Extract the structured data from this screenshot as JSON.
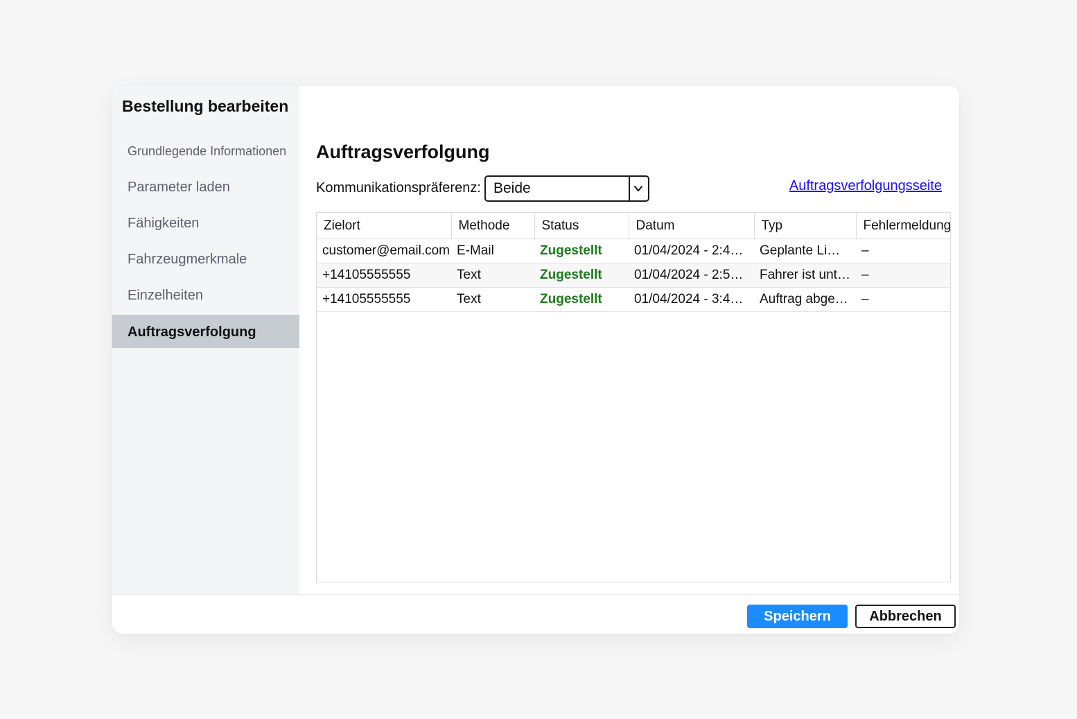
{
  "dialog": {
    "title": "Bestellung bearbeiten"
  },
  "sidebar": {
    "items": [
      {
        "label": "Grundlegende Informationen"
      },
      {
        "label": "Parameter laden"
      },
      {
        "label": "Fähigkeiten"
      },
      {
        "label": "Fahrzeugmerkmale"
      },
      {
        "label": "Einzelheiten"
      },
      {
        "label": "Auftragsverfolgung",
        "active": true
      }
    ]
  },
  "main": {
    "section_title": "Auftragsverfolgung",
    "preference_label": "Kommunikationspräferenz:",
    "preference_value": "Beide",
    "tracking_link": "Auftragsverfolgungsseite",
    "status_color": "#1c7a1c",
    "link_color": "#1a0dff",
    "table": {
      "columns": [
        "Zielort",
        "Methode",
        "Status",
        "Datum",
        "Typ",
        "Fehlermeldung"
      ],
      "rows": [
        {
          "zielort": "customer@email.com",
          "methode": "E-Mail",
          "status": "Zugestellt",
          "datum": "01/04/2024 - 2:4…",
          "typ": "Geplante Li…",
          "fehler": "–"
        },
        {
          "zielort": "+14105555555",
          "methode": "Text",
          "status": "Zugestellt",
          "datum": "01/04/2024 - 2:5…",
          "typ": "Fahrer ist unte…",
          "fehler": "–"
        },
        {
          "zielort": "+14105555555",
          "methode": "Text",
          "status": "Zugestellt",
          "datum": "01/04/2024 - 3:4…",
          "typ": "Auftrag abge…",
          "fehler": "–"
        }
      ]
    }
  },
  "footer": {
    "save_label": "Speichern",
    "cancel_label": "Abbrechen",
    "accent_color": "#1a8cff"
  }
}
